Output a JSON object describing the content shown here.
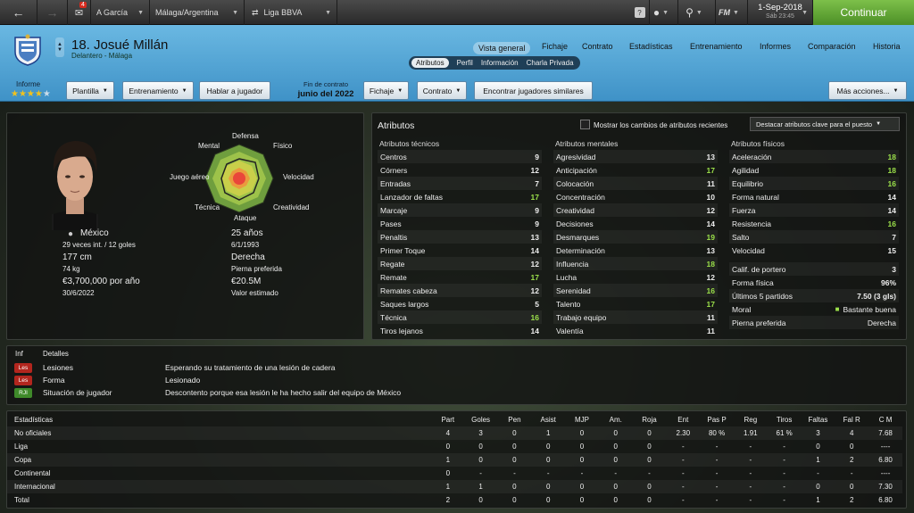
{
  "topbar": {
    "notif_count": "4",
    "manager": "A García",
    "club_nation": "Málaga/Argentina",
    "competition": "Liga BBVA",
    "date": "1-Sep-2018",
    "time": "Sáb 23:45",
    "continue": "Continuar",
    "fm_label": "FM"
  },
  "player": {
    "title": "18. Josué Millán",
    "subtitle": "Delantero - Málaga"
  },
  "nav": {
    "tabs": [
      "Vista general",
      "Fichaje",
      "Contrato",
      "Estadísticas",
      "Entrenamiento",
      "Informes",
      "Comparación",
      "Historia"
    ],
    "subtabs": [
      "Atributos",
      "Perfil",
      "Información",
      "Charla Privada"
    ]
  },
  "actionbar": {
    "informe": "Informe",
    "stars": 4,
    "plantilla": "Plantilla",
    "entrenamiento": "Entrenamiento",
    "hablar": "Hablar a jugador",
    "fin_label": "Fin de contrato",
    "fin_value": "junio del 2022",
    "fichaje": "Fichaje",
    "contrato": "Contrato",
    "encontrar": "Encontrar jugadores similares",
    "mas": "Más acciones..."
  },
  "radar": {
    "labels": [
      "Defensa",
      "Físico",
      "Velocidad",
      "Creatividad",
      "Ataque",
      "Técnica",
      "Juego aéreo",
      "Mental"
    ]
  },
  "info": {
    "nation": "México",
    "caps": "29 veces int. / 12 goles",
    "height": "177 cm",
    "weight": "74 kg",
    "wage": "€3,700,000 por año",
    "contract": "30/6/2022",
    "age": "25 años",
    "dob": "6/1/1993",
    "foot": "Derecha",
    "foot_label": "Pierna preferida",
    "value": "€20.5M",
    "value_label": "Valor estimado"
  },
  "attributes": {
    "title": "Atributos",
    "show_changes": "Mostrar los cambios de atributos recientes",
    "highlight": "Destacar atributos clave para el puesto",
    "tech_title": "Atributos técnicos",
    "ment_title": "Atributos mentales",
    "phys_title": "Atributos físicos",
    "technical": [
      [
        "Centros",
        "9"
      ],
      [
        "Córners",
        "12"
      ],
      [
        "Entradas",
        "7"
      ],
      [
        "Lanzador de faltas",
        "17"
      ],
      [
        "Marcaje",
        "9"
      ],
      [
        "Pases",
        "9"
      ],
      [
        "Penaltis",
        "13"
      ],
      [
        "Primer Toque",
        "14"
      ],
      [
        "Regate",
        "12"
      ],
      [
        "Remate",
        "17"
      ],
      [
        "Remates cabeza",
        "12"
      ],
      [
        "Saques largos",
        "5"
      ],
      [
        "Técnica",
        "16"
      ],
      [
        "Tiros lejanos",
        "14"
      ]
    ],
    "mental": [
      [
        "Agresividad",
        "13"
      ],
      [
        "Anticipación",
        "17"
      ],
      [
        "Colocación",
        "11"
      ],
      [
        "Concentración",
        "10"
      ],
      [
        "Creatividad",
        "12"
      ],
      [
        "Decisiones",
        "14"
      ],
      [
        "Desmarques",
        "19"
      ],
      [
        "Determinación",
        "13"
      ],
      [
        "Influencia",
        "18"
      ],
      [
        "Lucha",
        "12"
      ],
      [
        "Serenidad",
        "16"
      ],
      [
        "Talento",
        "17"
      ],
      [
        "Trabajo equipo",
        "11"
      ],
      [
        "Valentía",
        "11"
      ]
    ],
    "physical": [
      [
        "Aceleración",
        "18"
      ],
      [
        "Agilidad",
        "18"
      ],
      [
        "Equilibrio",
        "16"
      ],
      [
        "Forma natural",
        "14"
      ],
      [
        "Fuerza",
        "14"
      ],
      [
        "Resistencia",
        "16"
      ],
      [
        "Salto",
        "7"
      ],
      [
        "Velocidad",
        "15"
      ]
    ],
    "extra": [
      [
        "Calif. de portero",
        "3"
      ],
      [
        "Forma física",
        "96%"
      ],
      [
        "Últimos 5 partidos",
        "7.50 (3 gls)"
      ],
      [
        "Moral",
        "Bastante buena"
      ],
      [
        "Pierna preferida",
        "Derecha"
      ]
    ]
  },
  "details": {
    "col1": "Inf",
    "col2": "Detalles",
    "rows": [
      {
        "badge": "Les",
        "label": "Lesiones",
        "text": "Esperando su tratamiento de una lesión de cadera",
        "color": "#b3261e"
      },
      {
        "badge": "Les",
        "label": "Forma",
        "text": "Lesionado",
        "color": "#b3261e"
      },
      {
        "badge": "RJI",
        "label": "Situación de jugador",
        "text": "Descontento porque esa lesión le ha hecho salir del equipo de México",
        "color": "#3f8a2a"
      }
    ]
  },
  "stats": {
    "headers": [
      "Estadísticas",
      "Part",
      "Goles",
      "Pen",
      "Asist",
      "MJP",
      "Am.",
      "Roja",
      "Ent",
      "Pas P",
      "Reg",
      "Tiros",
      "Faltas",
      "Fal R",
      "C M"
    ],
    "rows": [
      [
        "No oficiales",
        "4",
        "3",
        "0",
        "1",
        "0",
        "0",
        "0",
        "2.30",
        "80 %",
        "1.91",
        "61 %",
        "3",
        "4",
        "7.68"
      ],
      [
        "Liga",
        "0",
        "0",
        "0",
        "0",
        "0",
        "0",
        "0",
        "-",
        "-",
        "-",
        "-",
        "0",
        "0",
        "----"
      ],
      [
        "Copa",
        "1",
        "0",
        "0",
        "0",
        "0",
        "0",
        "0",
        "-",
        "-",
        "-",
        "-",
        "1",
        "2",
        "6.80"
      ],
      [
        "Continental",
        "0",
        "-",
        "-",
        "-",
        "-",
        "-",
        "-",
        "-",
        "-",
        "-",
        "-",
        "-",
        "-",
        "----"
      ],
      [
        "Internacional",
        "1",
        "1",
        "0",
        "0",
        "0",
        "0",
        "0",
        "-",
        "-",
        "-",
        "-",
        "0",
        "0",
        "7.30"
      ],
      [
        "Total",
        "2",
        "0",
        "0",
        "0",
        "0",
        "0",
        "0",
        "-",
        "-",
        "-",
        "-",
        "1",
        "2",
        "6.80"
      ]
    ]
  },
  "colors": {
    "accent": "#6ab8e2",
    "green": "#9be04a",
    "continue": "#5aa22f"
  }
}
